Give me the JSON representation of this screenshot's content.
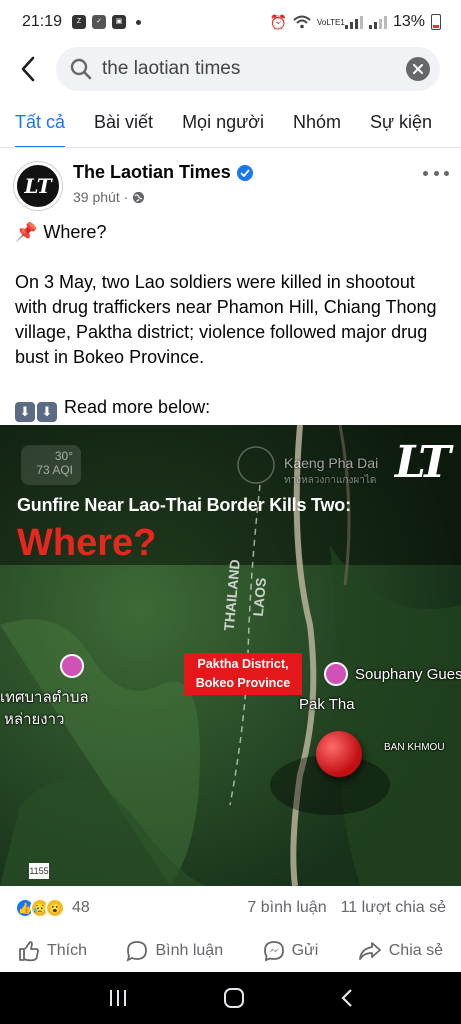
{
  "status_bar": {
    "time": "21:19",
    "battery": "13%",
    "network": "VoLTE1"
  },
  "search": {
    "query": "the laotian times",
    "back_icon": "back-arrow-icon",
    "search_icon": "search-icon",
    "clear_icon": "clear-icon"
  },
  "tabs": [
    {
      "label": "Tất cả",
      "active": true
    },
    {
      "label": "Bài viết",
      "active": false
    },
    {
      "label": "Mọi người",
      "active": false
    },
    {
      "label": "Nhóm",
      "active": false
    },
    {
      "label": "Sự kiện",
      "active": false
    }
  ],
  "post": {
    "page_name": "The Laotian Times",
    "avatar_text": "LT",
    "time": "39 phút",
    "privacy_icon": "globe-icon",
    "pin_line": "Where?",
    "body": "On 3 May, two Lao soldiers were killed in shootout with drug traffickers near Phamon Hill, Chiang Thong village, Paktha district; violence followed major drug bust in Bokeo Province.",
    "read_more": "Read more below:",
    "image": {
      "headline": "Gunfire Near Lao-Thai Border Kills Two:",
      "where": "Where?",
      "logo": "LT",
      "weather_temp": "30°",
      "weather_aqi": "73 AQI",
      "label_keng": "Kaeng Pha Dai",
      "label_thai_small": "ทางหลวงกาแกงผาได",
      "label_thailand": "THAILAND",
      "label_laos": "LAOS",
      "callout_line1": "Paktha District,",
      "callout_line2": "Bokeo Province",
      "label_souphany": "Souphany Gues",
      "label_pak_tha": "Pak Tha",
      "label_ban_khmou": "BAN KHMOU",
      "label_thai_1": "เทศบาลตำบล",
      "label_thai_2": "หล่ายงาว",
      "road_number": "1155",
      "accent": "#e8251f"
    },
    "reactions": {
      "count": "48",
      "comments": "7 bình luận",
      "shares": "11 lượt chia sẻ"
    },
    "actions": {
      "like": "Thích",
      "comment": "Bình luận",
      "send": "Gửi",
      "share": "Chia sẻ"
    }
  },
  "colors": {
    "brand": "#1877f2",
    "text": "#050505",
    "secondary": "#65676b"
  }
}
